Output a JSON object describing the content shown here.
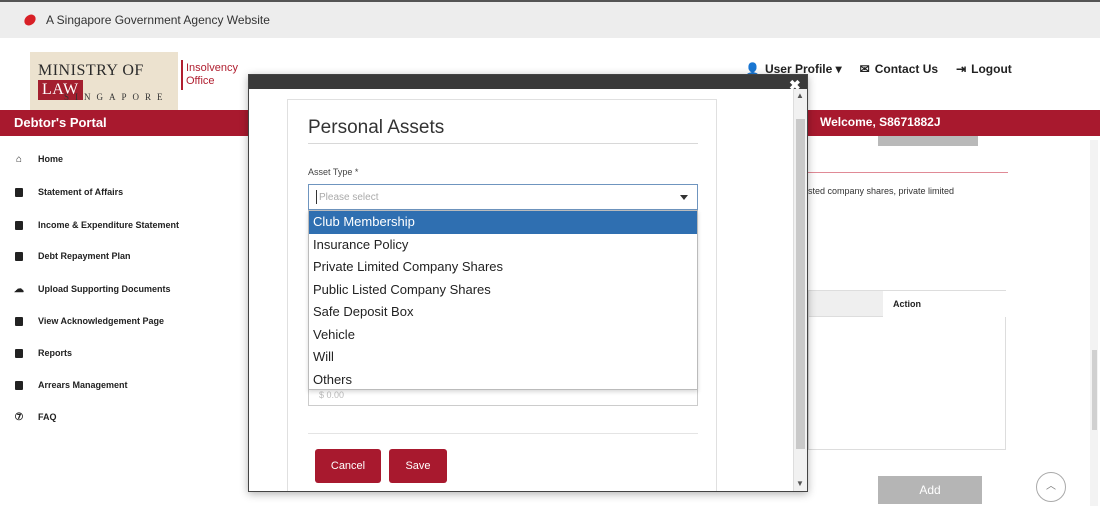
{
  "gov_banner": {
    "text": "A Singapore Government Agency Website"
  },
  "header": {
    "logo_main": "MINISTRY OF",
    "logo_law": "LAW",
    "logo_sub": "SINGAPORE",
    "logo_office_line1": "Insolvency",
    "logo_office_line2": "Office",
    "nav": {
      "user_profile": "User Profile ▾",
      "contact_us": "Contact Us",
      "logout": "Logout"
    }
  },
  "red_bar": {
    "portal": "Debtor's Portal",
    "welcome": "Welcome, S8671882J"
  },
  "sidebar": {
    "items": [
      {
        "label": "Home",
        "icon": "home-icon"
      },
      {
        "label": "Statement of Affairs",
        "icon": "document-icon"
      },
      {
        "label": "Income & Expenditure Statement",
        "icon": "ledger-icon"
      },
      {
        "label": "Debt Repayment Plan",
        "icon": "plan-icon"
      },
      {
        "label": "Upload Supporting Documents",
        "icon": "cloud-upload-icon"
      },
      {
        "label": "View Acknowledgement Page",
        "icon": "acknowledgement-icon"
      },
      {
        "label": "Reports",
        "icon": "report-icon"
      },
      {
        "label": "Arrears Management",
        "icon": "arrears-icon"
      },
      {
        "label": "FAQ",
        "icon": "help-icon"
      }
    ]
  },
  "background": {
    "shares_text": "sted company shares, private limited",
    "table_action_header": "Action",
    "add_button": "Add"
  },
  "modal": {
    "title": "Personal Assets",
    "asset_type_label": "Asset Type *",
    "asset_type_placeholder": "Please select",
    "options": [
      "Club Membership",
      "Insurance Policy",
      "Private Limited Company Shares",
      "Public Listed Company Shares",
      "Safe Deposit Box",
      "Vehicle",
      "Will",
      "Others"
    ],
    "selected_index": 0,
    "hidden_value_placeholder": "$ 0.00",
    "cancel": "Cancel",
    "save": "Save"
  },
  "colors": {
    "brand_red": "#a8192e",
    "selection_blue": "#2f6fb1"
  }
}
